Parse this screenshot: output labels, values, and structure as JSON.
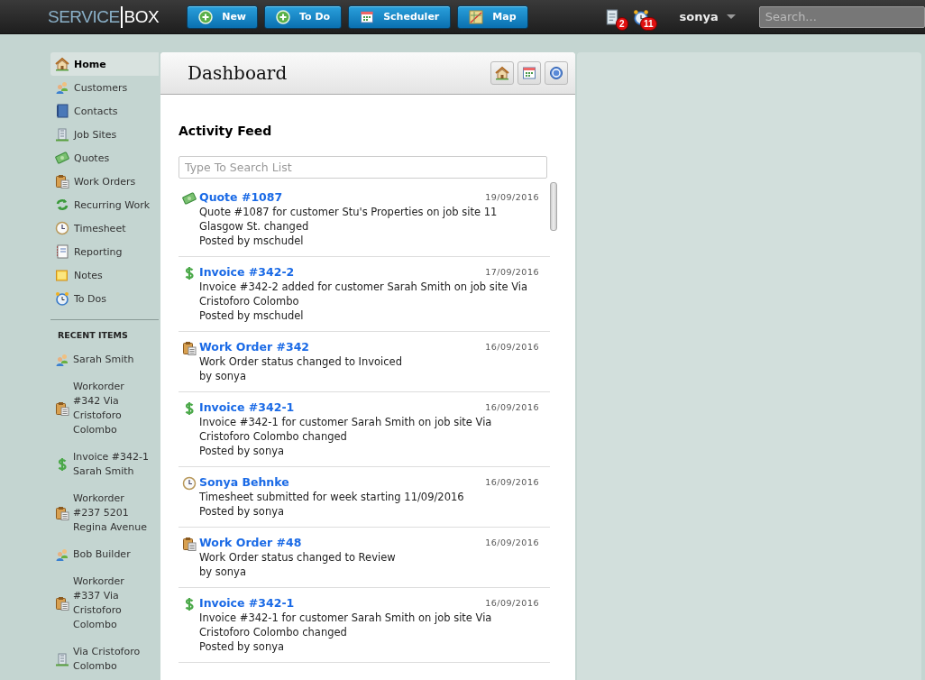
{
  "logo": {
    "left": "SERVICE",
    "right": "BOX"
  },
  "toolbar_buttons": [
    {
      "label": "New",
      "kind": "plus"
    },
    {
      "label": "To Do",
      "kind": "plus"
    },
    {
      "label": "Scheduler",
      "kind": "calendar"
    },
    {
      "label": "Map",
      "kind": "map"
    }
  ],
  "notifications": [
    {
      "kind": "document",
      "count": "2"
    },
    {
      "kind": "alarm",
      "count": "11"
    }
  ],
  "user": {
    "name": "sonya"
  },
  "search": {
    "placeholder": "Search..."
  },
  "sidebar": {
    "items": [
      {
        "label": "Home",
        "kind": "home",
        "selected": true
      },
      {
        "label": "Customers",
        "kind": "customers",
        "selected": false
      },
      {
        "label": "Contacts",
        "kind": "contacts",
        "selected": false
      },
      {
        "label": "Job Sites",
        "kind": "building",
        "selected": false
      },
      {
        "label": "Quotes",
        "kind": "money",
        "selected": false
      },
      {
        "label": "Work Orders",
        "kind": "clipboard",
        "selected": false
      },
      {
        "label": "Recurring Work",
        "kind": "recurring",
        "selected": false
      },
      {
        "label": "Timesheet",
        "kind": "clock",
        "selected": false
      },
      {
        "label": "Reporting",
        "kind": "report",
        "selected": false
      },
      {
        "label": "Notes",
        "kind": "note",
        "selected": false
      },
      {
        "label": "To Dos",
        "kind": "alarm",
        "selected": false
      }
    ],
    "recent_heading": "RECENT ITEMS",
    "recent_items": [
      {
        "label": "Sarah Smith",
        "kind": "customers"
      },
      {
        "label": "Workorder #342 Via Cristoforo Colombo",
        "kind": "clipboard"
      },
      {
        "label": "Invoice #342-1 Sarah Smith",
        "kind": "dollar"
      },
      {
        "label": "Workorder #237 5201 Regina Avenue",
        "kind": "clipboard"
      },
      {
        "label": "Bob Builder",
        "kind": "customers"
      },
      {
        "label": "Workorder #337 Via Cristoforo Colombo",
        "kind": "clipboard"
      },
      {
        "label": "Via Cristoforo Colombo",
        "kind": "building"
      }
    ]
  },
  "dashboard": {
    "title": "Dashboard",
    "header_buttons": [
      {
        "kind": "home"
      },
      {
        "kind": "calendar"
      },
      {
        "kind": "help"
      }
    ],
    "feed_title": "Activity Feed",
    "feed_search": {
      "placeholder": "Type To Search List"
    },
    "feed": [
      {
        "kind": "money",
        "title": "Quote #1087",
        "date": "19/09/2016",
        "text": "Quote #1087 for customer Stu's Properties on job site 11 Glasgow St. changed",
        "by": "Posted by mschudel"
      },
      {
        "kind": "dollar",
        "title": "Invoice #342-2",
        "date": "17/09/2016",
        "text": "Invoice #342-2 added for customer Sarah Smith on job site Via Cristoforo Colombo",
        "by": "Posted by mschudel"
      },
      {
        "kind": "clipboard",
        "title": "Work Order #342",
        "date": "16/09/2016",
        "text": "Work Order status changed to Invoiced",
        "by": "by sonya"
      },
      {
        "kind": "dollar",
        "title": "Invoice #342-1",
        "date": "16/09/2016",
        "text": "Invoice #342-1 for customer Sarah Smith on job site Via Cristoforo Colombo changed",
        "by": "Posted by sonya"
      },
      {
        "kind": "clock",
        "title": "Sonya Behnke",
        "date": "16/09/2016",
        "text": "Timesheet submitted for week starting 11/09/2016",
        "by": "Posted by sonya"
      },
      {
        "kind": "clipboard",
        "title": "Work Order #48",
        "date": "16/09/2016",
        "text": "Work Order status changed to Review",
        "by": "by sonya"
      },
      {
        "kind": "dollar",
        "title": "Invoice #342-1",
        "date": "16/09/2016",
        "text": "Invoice #342-1 for customer Sarah Smith on job site Via Cristoforo Colombo changed",
        "by": "Posted by sonya"
      }
    ]
  }
}
